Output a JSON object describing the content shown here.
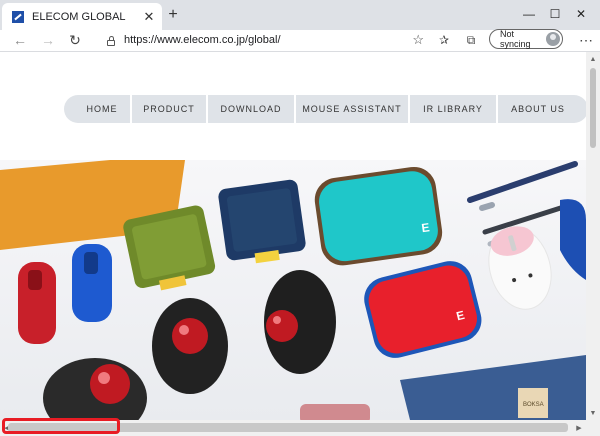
{
  "tab": {
    "title": "ELECOM GLOBAL"
  },
  "address_bar": {
    "url": "https://www.elecom.co.jp/global/"
  },
  "profile": {
    "sync_label": "Not syncing"
  },
  "icons": {
    "back": "arrow-left-icon",
    "forward": "arrow-right-icon",
    "refresh": "refresh-icon",
    "lock": "lock-icon",
    "star": "star-icon",
    "favorites": "favorites-icon",
    "collections": "collections-icon",
    "more": "more-icon",
    "minimize": "minimize-icon",
    "maximize": "maximize-icon",
    "close": "close-icon"
  },
  "site_nav": {
    "items": [
      {
        "label": "HOME"
      },
      {
        "label": "PRODUCT"
      },
      {
        "label": "DOWNLOAD"
      },
      {
        "label": "MOUSE ASSISTANT"
      },
      {
        "label": "IR LIBRARY"
      },
      {
        "label": "ABOUT US"
      }
    ]
  },
  "hero_products": {
    "pouch_labels": [
      "E",
      "E"
    ],
    "tag_text": "BOKSA"
  },
  "colors": {
    "accent_highlight": "#e81c24",
    "nav_pill": "#dfe3e8",
    "cyan_pouch": "#1fc7c9",
    "red_pouch": "#e8202c",
    "blue_mouse": "#1d4fb3"
  }
}
